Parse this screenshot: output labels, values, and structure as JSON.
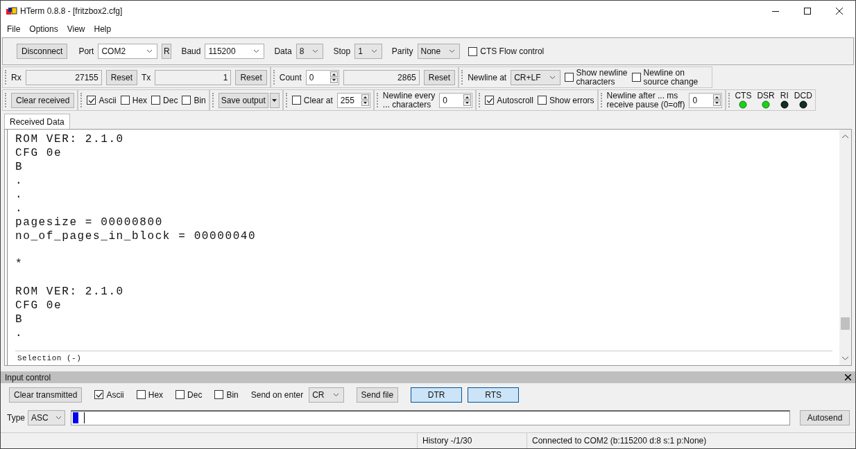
{
  "window": {
    "title": "HTerm 0.8.8 - [fritzbox2.cfg]"
  },
  "menu": [
    "File",
    "Options",
    "View",
    "Help"
  ],
  "connection": [
    {
      "kind": "button",
      "label": "Disconnect"
    },
    {
      "kind": "label",
      "text": "Port"
    },
    {
      "kind": "combo",
      "value": "COM2"
    },
    {
      "kind": "small-button",
      "label": "R"
    },
    {
      "kind": "label",
      "text": "Baud"
    },
    {
      "kind": "combo",
      "value": "115200"
    },
    {
      "kind": "label",
      "text": "Data"
    },
    {
      "kind": "select",
      "value": "8"
    },
    {
      "kind": "label",
      "text": "Stop"
    },
    {
      "kind": "select",
      "value": "1"
    },
    {
      "kind": "label",
      "text": "Parity"
    },
    {
      "kind": "select",
      "value": "None"
    },
    {
      "kind": "checkbox",
      "label": "CTS Flow control",
      "checked": false
    }
  ],
  "toolbar_rows": [
    [
      [
        {
          "kind": "label",
          "text": "Rx"
        },
        {
          "kind": "readout",
          "value": "27155"
        },
        {
          "kind": "button",
          "label": "Reset"
        },
        {
          "kind": "label",
          "text": "Tx"
        },
        {
          "kind": "readout",
          "value": "1"
        },
        {
          "kind": "button",
          "label": "Reset"
        }
      ],
      [
        {
          "kind": "label",
          "text": "Count"
        },
        {
          "kind": "spin",
          "value": "0"
        },
        {
          "kind": "readout",
          "value": "2865"
        },
        {
          "kind": "button",
          "label": "Reset"
        }
      ],
      [
        {
          "kind": "label",
          "text": "Newline at"
        },
        {
          "kind": "select",
          "value": "CR+LF"
        },
        {
          "kind": "checkbox",
          "lines": [
            "Show newline",
            "characters"
          ],
          "checked": false
        },
        {
          "kind": "checkbox",
          "lines": [
            "Newline on",
            "source change"
          ],
          "checked": false
        }
      ]
    ],
    [
      [
        {
          "kind": "button",
          "label": "Clear received"
        }
      ],
      [
        {
          "kind": "checkbox",
          "label": "Ascii",
          "checked": true
        },
        {
          "kind": "checkbox",
          "label": "Hex",
          "checked": false
        },
        {
          "kind": "checkbox",
          "label": "Dec",
          "checked": false
        },
        {
          "kind": "checkbox",
          "label": "Bin",
          "checked": false
        }
      ],
      [
        {
          "kind": "split-button",
          "label": "Save output"
        }
      ],
      [
        {
          "kind": "checkbox",
          "label": "Clear at",
          "checked": false
        },
        {
          "kind": "spin",
          "value": "255"
        }
      ],
      [
        {
          "kind": "label",
          "lines": [
            "Newline every",
            "... characters"
          ]
        },
        {
          "kind": "spin",
          "value": "0"
        }
      ],
      [
        {
          "kind": "checkbox",
          "label": "Autoscroll",
          "checked": true
        },
        {
          "kind": "checkbox",
          "label": "Show errors",
          "checked": false
        }
      ],
      [
        {
          "kind": "label",
          "lines": [
            "Newline after ... ms",
            "receive pause (0=off)"
          ]
        },
        {
          "kind": "spin",
          "value": "0"
        }
      ],
      [
        {
          "kind": "leds",
          "items": [
            {
              "label": "CTS",
              "on": true
            },
            {
              "label": "DSR",
              "on": true
            },
            {
              "label": "RI",
              "on": false
            },
            {
              "label": "DCD",
              "on": false
            }
          ]
        }
      ]
    ]
  ],
  "tabs": [
    {
      "label": "Received Data",
      "selected": true
    }
  ],
  "received_lines": [
    {
      "kind": "text",
      "text": "ROM VER: 2.1.0"
    },
    {
      "kind": "text",
      "text": "CFG 0e"
    },
    {
      "kind": "text",
      "text": "B"
    },
    {
      "kind": "text",
      "text": "."
    },
    {
      "kind": "text",
      "text": "."
    },
    {
      "kind": "text",
      "text": "."
    },
    {
      "kind": "text",
      "text": "pagesize = 00000800"
    },
    {
      "kind": "text",
      "text": "no_of_pages_in_block = 00000040"
    },
    {
      "kind": "blank"
    },
    {
      "kind": "text",
      "text": "*"
    },
    {
      "kind": "blank"
    },
    {
      "kind": "text",
      "text": "ROM VER: 2.1.0"
    },
    {
      "kind": "text",
      "text": "CFG 0e"
    },
    {
      "kind": "text",
      "text": "B"
    },
    {
      "kind": "text",
      "text": "."
    }
  ],
  "selection": "Selection (-)",
  "input_control": {
    "title": "Input control",
    "items": [
      {
        "kind": "button",
        "label": "Clear transmitted"
      },
      {
        "kind": "checkbox",
        "label": "Ascii",
        "checked": true
      },
      {
        "kind": "checkbox",
        "label": "Hex",
        "checked": false
      },
      {
        "kind": "checkbox",
        "label": "Dec",
        "checked": false
      },
      {
        "kind": "checkbox",
        "label": "Bin",
        "checked": false
      },
      {
        "kind": "label",
        "text": "Send on enter"
      },
      {
        "kind": "select",
        "value": "CR"
      },
      {
        "kind": "button",
        "label": "Send file"
      },
      {
        "kind": "toggle",
        "label": "DTR",
        "on": true
      },
      {
        "kind": "toggle",
        "label": "RTS",
        "on": true
      }
    ],
    "type_label": "Type",
    "type_value": "ASC",
    "send_button": "Autosend"
  },
  "status_bar": [
    "History -/1/30",
    "Connected to COM2 (b:115200 d:8 s:1 p:None)"
  ]
}
